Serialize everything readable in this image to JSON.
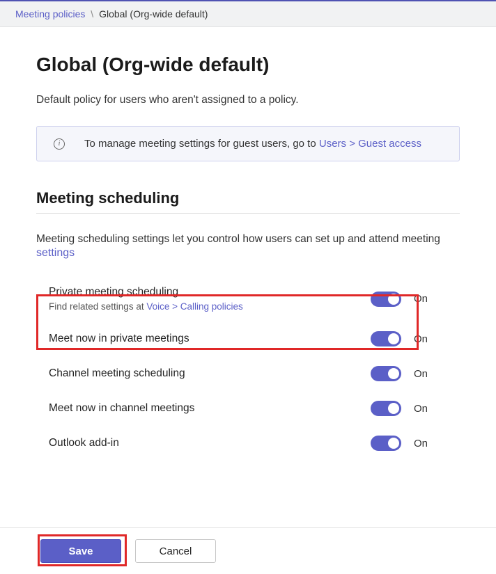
{
  "breadcrumb": {
    "link": "Meeting policies",
    "separator": "\\",
    "current": "Global (Org-wide default)"
  },
  "page": {
    "title": "Global (Org-wide default)",
    "description": "Default policy for users who aren't assigned to a policy."
  },
  "info_banner": {
    "text_before": "To manage meeting settings for guest users, go to ",
    "link": "Users > Guest access"
  },
  "section": {
    "title": "Meeting scheduling",
    "desc_before": "Meeting scheduling settings let you control how users can set up and attend meeting",
    "desc_link": "settings"
  },
  "settings": [
    {
      "label": "Private meeting scheduling",
      "has_sub": true,
      "sub_before": "Find related settings at ",
      "sub_link": "Voice > Calling policies",
      "state": "On"
    },
    {
      "label": "Meet now in private meetings",
      "state": "On"
    },
    {
      "label": "Channel meeting scheduling",
      "state": "On"
    },
    {
      "label": "Meet now in channel meetings",
      "state": "On"
    },
    {
      "label": "Outlook add-in",
      "state": "On"
    }
  ],
  "footer": {
    "save": "Save",
    "cancel": "Cancel"
  }
}
